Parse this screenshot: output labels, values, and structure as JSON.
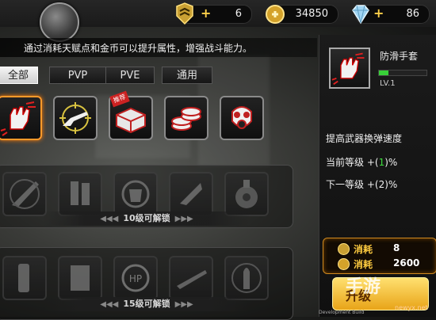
{
  "topbar": {
    "talent_points": "6",
    "gold": "34850",
    "diamonds": "86"
  },
  "description": "通过消耗天赋点和金币可以提升属性，增强战斗能力。",
  "tabs": [
    "全部",
    "PVP",
    "PVE",
    "通用"
  ],
  "active_tab": "全部",
  "row1": {
    "items": [
      {
        "icon": "glove-icon",
        "state": "selected"
      },
      {
        "icon": "rifle-crosshair-icon",
        "state": "unlocked"
      },
      {
        "icon": "ammo-box-icon",
        "state": "unlocked",
        "badge": "推荐"
      },
      {
        "icon": "coin-stack-icon",
        "state": "unlocked"
      },
      {
        "icon": "gas-mask-icon",
        "state": "unlocked"
      }
    ]
  },
  "row2": {
    "unlock_label": "10级可解锁",
    "items": [
      {
        "icon": "knife-icon",
        "state": "locked"
      },
      {
        "icon": "magazine-icon",
        "state": "locked"
      },
      {
        "icon": "armor-vest-icon",
        "state": "locked"
      },
      {
        "icon": "blade-icon",
        "state": "locked"
      },
      {
        "icon": "biohazard-grenade-icon",
        "state": "locked"
      }
    ]
  },
  "row3": {
    "unlock_label": "15级可解锁",
    "items": [
      {
        "icon": "flashlight-icon",
        "state": "locked"
      },
      {
        "icon": "ammo-clip-icon",
        "state": "locked"
      },
      {
        "icon": "hp-emblem-icon",
        "state": "locked"
      },
      {
        "icon": "sniper-rifle-icon",
        "state": "locked"
      },
      {
        "icon": "bullet-icon",
        "state": "locked"
      }
    ]
  },
  "detail": {
    "name": "防滑手套",
    "level": "LV.1",
    "level_progress": 0.2,
    "effect": "提高武器换弹速度",
    "current_label": "当前等级",
    "current_prefix": "+(",
    "current_value": "1",
    "current_suffix": ")%",
    "next_label": "下一等级",
    "next_value": "+(2)%"
  },
  "cost": {
    "label": "消耗",
    "talent_cost": "8",
    "gold_cost": "2600"
  },
  "upgrade_button": "升级",
  "watermark": "手游",
  "watermark_sub": "newyx.net",
  "dev_text": "Development Build",
  "colors": {
    "accent_orange": "#ff9a2a",
    "gold": "#ffcc40",
    "green": "#3ddc3d"
  }
}
